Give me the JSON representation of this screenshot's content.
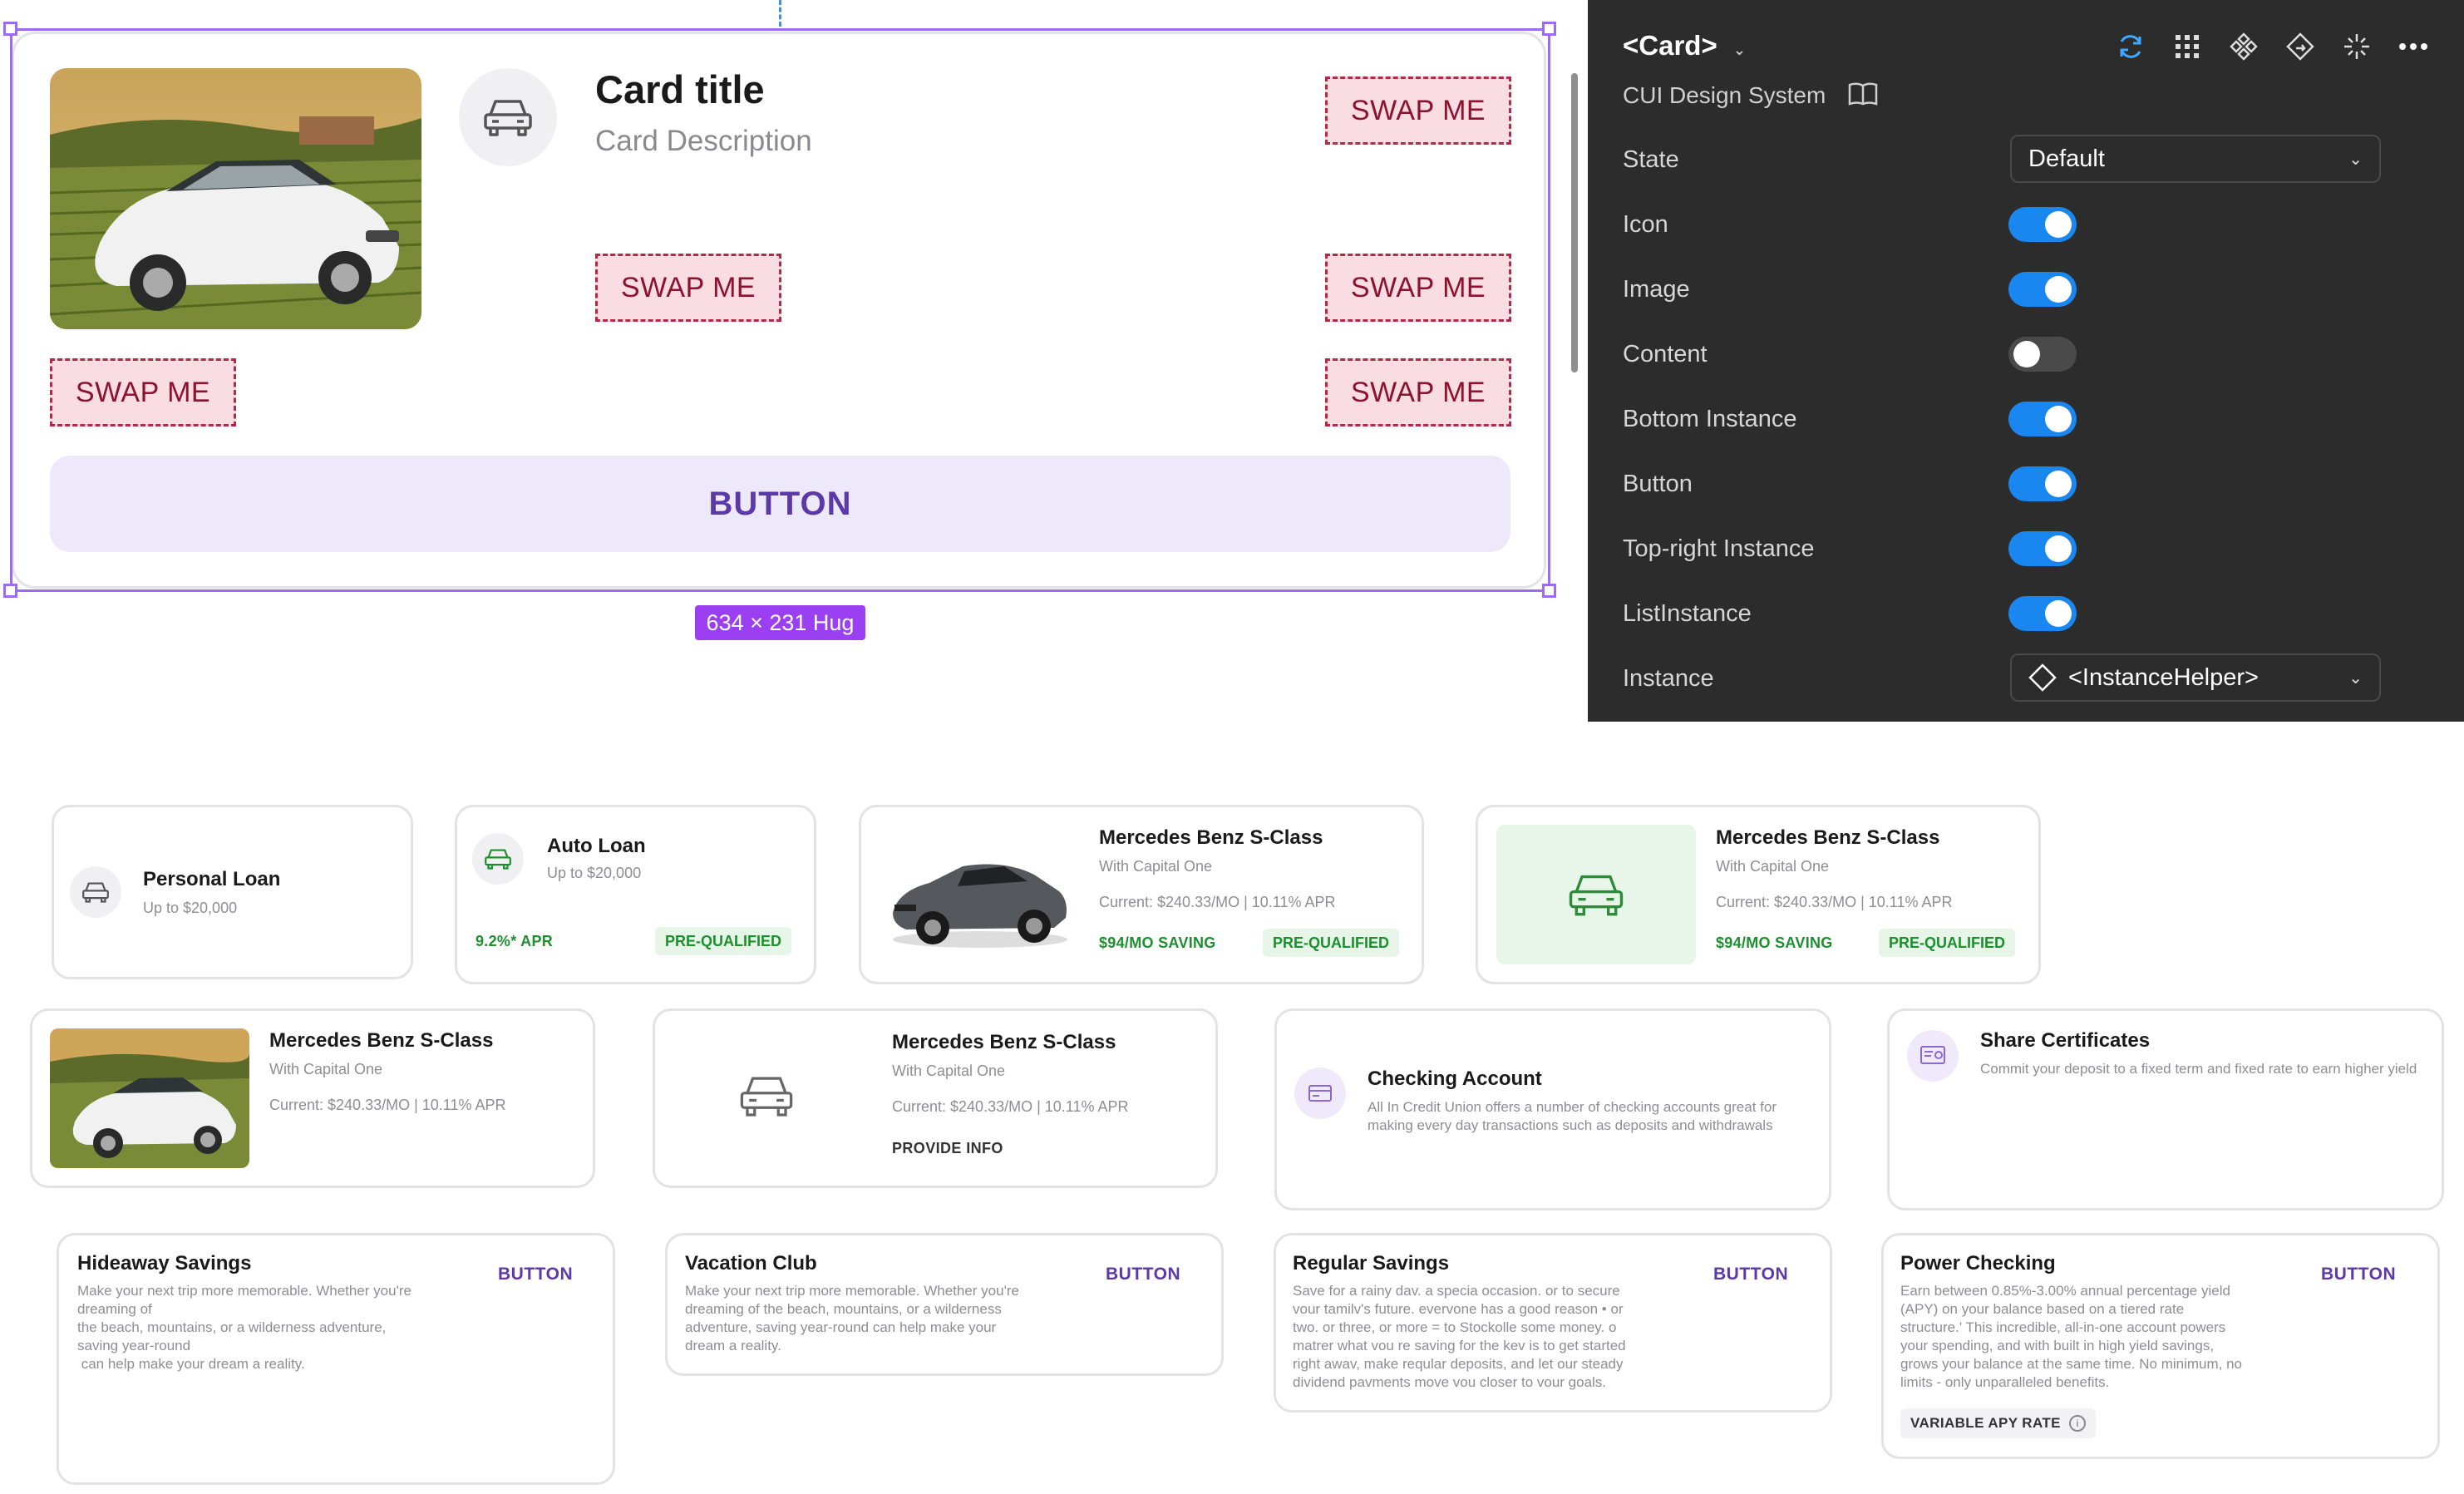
{
  "hero": {
    "title": "Card title",
    "description": "Card Description",
    "swap_label": "SWAP ME",
    "button_label": "BUTTON",
    "size_badge": "634 × 231 Hug"
  },
  "panel": {
    "component_name": "<Card>",
    "design_system": "CUI Design System",
    "state": {
      "label": "State",
      "value": "Default"
    },
    "toggles": [
      {
        "label": "Icon",
        "on": true
      },
      {
        "label": "Image",
        "on": true
      },
      {
        "label": "Content",
        "on": false
      },
      {
        "label": "Bottom Instance",
        "on": true
      },
      {
        "label": "Button",
        "on": true
      },
      {
        "label": "Top-right Instance",
        "on": true
      },
      {
        "label": "ListInstance",
        "on": true
      }
    ],
    "instance": {
      "label": "Instance",
      "value": "<InstanceHelper>"
    },
    "tool_icons": [
      "refresh-icon",
      "grid-icon",
      "component-icon",
      "swap-instance-icon",
      "sparkle-icon",
      "more-icon"
    ]
  },
  "cards": {
    "personal_loan": {
      "title": "Personal Loan",
      "sub": "Up to $20,000"
    },
    "auto_loan": {
      "title": "Auto Loan",
      "sub": "Up to $20,000",
      "apr": "9.2%* APR",
      "badge": "PRE-QUALIFIED"
    },
    "mercedes_photo": {
      "title": "Mercedes Benz S-Class",
      "sub": "With Capital One",
      "current": "Current: $240.33/MO | 10.11% APR",
      "saving": "$94/MO SAVING",
      "badge": "PRE-QUALIFIED"
    },
    "mercedes_icon": {
      "title": "Mercedes Benz S-Class",
      "sub": "With Capital One",
      "current": "Current: $240.33/MO | 10.11% APR",
      "saving": "$94/MO SAVING",
      "badge": "PRE-QUALIFIED"
    },
    "mercedes_image_row": {
      "title": "Mercedes Benz S-Class",
      "sub": "With Capital One",
      "current": "Current: $240.33/MO | 10.11% APR"
    },
    "mercedes_provide": {
      "title": "Mercedes Benz S-Class",
      "sub": "With Capital One",
      "current": "Current: $240.33/MO | 10.11% APR",
      "action": "PROVIDE INFO"
    },
    "checking": {
      "title": "Checking Account",
      "body": "All In Credit Union offers a number of checking accounts great for making every day transactions such as deposits and withdrawals"
    },
    "share_certificates": {
      "title": "Share Certificates",
      "body": "Commit your deposit to a fixed term and fixed rate to earn higher yield"
    },
    "hideaway": {
      "title": "Hideaway Savings",
      "button": "BUTTON",
      "lines": [
        "Make your next trip more memorable. Whether you're",
        "dreaming of",
        "the beach, mountains, or a wilderness adventure,",
        "saving year-round",
        " can help make your dream a reality."
      ]
    },
    "vacation": {
      "title": "Vacation Club",
      "button": "BUTTON",
      "lines": [
        "Make your next trip more memorable. Whether you're",
        "dreaming of the beach, mountains, or a wilderness",
        "adventure, saving year-round can help make your",
        "dream a reality."
      ]
    },
    "regular": {
      "title": "Regular Savings",
      "button": "BUTTON",
      "lines": [
        "Save for a rainy dav. a specia occasion. or to secure",
        "vour tamilv's future. evervone has a good reason • or",
        "two. or three, or more = to Stockolle some money. o",
        "matrer what vou re saving for the kev is to get started",
        "right awav, make reqular deposits, and let our steady",
        "dividend pavments move vou closer to vour goals."
      ]
    },
    "power": {
      "title": "Power Checking",
      "button": "BUTTON",
      "badge": "VARIABLE APY RATE",
      "lines": [
        "Earn between 0.85%-3.00% annual percentage yield",
        "(APY) on your balance based on a tiered rate",
        "structure.' This incredible, all-in-one account powers",
        "your spending, and with built in high yield savings,",
        "grows your balance at the same time. No minimum, no",
        "limits - only unparalleled benefits."
      ]
    }
  },
  "colors": {
    "selection": "#9b6bf2",
    "panel_bg": "#2c2c2c",
    "toggle_on": "#1a86f0",
    "swap_bg": "#fadde2",
    "button_bg": "#eee9fa",
    "accent_purple": "#5b3aa8",
    "success_green": "#1c8f2e"
  }
}
